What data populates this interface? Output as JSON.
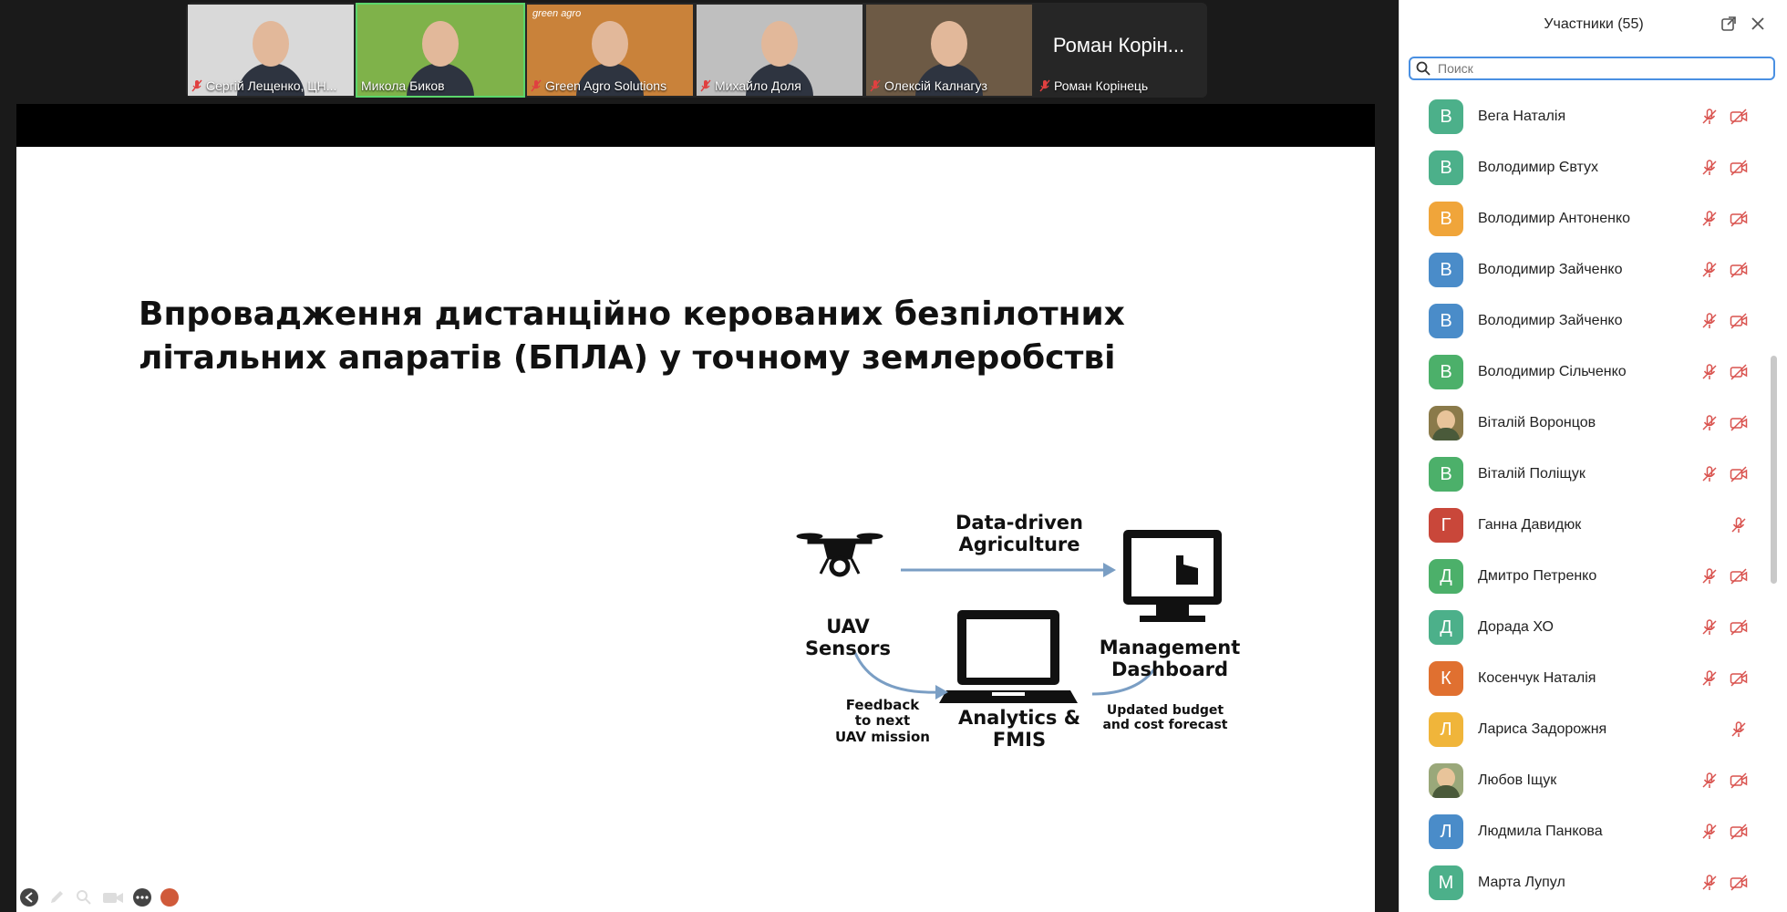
{
  "video_strip": {
    "tiles": [
      {
        "name": "Сергій Лещенко, ЦН...",
        "muted": true,
        "bg": "#d9d9d9"
      },
      {
        "name": "Микола Биков",
        "muted": false,
        "bg": "#7fb24a"
      },
      {
        "name": "Green Agro Solutions",
        "muted": true,
        "bg": "#c9823a",
        "logo_text": "green agro"
      },
      {
        "name": "Михайло Доля",
        "muted": true,
        "bg": "#bfbfbf"
      },
      {
        "name": "Олексій Калнагуз",
        "muted": true,
        "bg": "#6d5a45"
      },
      {
        "name": "Роман Корінець",
        "muted": true,
        "bg": "#262626",
        "display_name": "Роман Корін..."
      }
    ]
  },
  "slide": {
    "title_line1": "Впровадження дистанційно керованих безпілотних",
    "title_line2": "літальних апаратів (БПЛА) у точному землеробстві",
    "diagram": {
      "uav_label": "UAV\nSensors",
      "data_label": "Data-driven\nAgriculture",
      "dashboard_label": "Management\nDashboard",
      "analytics_label": "Analytics &\nFMIS",
      "feedback_label": "Feedback\nto next\nUAV mission",
      "update_label": "Updated budget\nand cost forecast"
    }
  },
  "panel": {
    "title": "Участники (55)",
    "search_placeholder": "Поиск",
    "participants": [
      {
        "initial": "В",
        "name": "Вега Наталія",
        "color": "#4cb08a",
        "mic_off": true,
        "video_off": true
      },
      {
        "initial": "В",
        "name": "Володимир Євтух",
        "color": "#4cb08a",
        "mic_off": true,
        "video_off": true
      },
      {
        "initial": "В",
        "name": "Володимир Антоненко",
        "color": "#f0a53a",
        "mic_off": true,
        "video_off": true
      },
      {
        "initial": "В",
        "name": "Володимир Зайченко",
        "color": "#4a8cc9",
        "mic_off": true,
        "video_off": true
      },
      {
        "initial": "В",
        "name": "Володимир Зайченко",
        "color": "#4a8cc9",
        "mic_off": true,
        "video_off": true
      },
      {
        "initial": "В",
        "name": "Володимир Сільченко",
        "color": "#4cb06a",
        "mic_off": true,
        "video_off": true
      },
      {
        "initial": "",
        "name": "Віталій Воронцов",
        "color": "#8a7a4a",
        "mic_off": true,
        "video_off": true,
        "photo": true
      },
      {
        "initial": "В",
        "name": "Віталій Поліщук",
        "color": "#4cb06a",
        "mic_off": true,
        "video_off": true
      },
      {
        "initial": "Г",
        "name": "Ганна Давидюк",
        "color": "#c9473a",
        "mic_off": true,
        "video_off": false
      },
      {
        "initial": "Д",
        "name": "Дмитро Петренко",
        "color": "#4cb06a",
        "mic_off": true,
        "video_off": true
      },
      {
        "initial": "Д",
        "name": "Дорада ХО",
        "color": "#4cb08a",
        "mic_off": true,
        "video_off": true
      },
      {
        "initial": "К",
        "name": "Косенчук Наталія",
        "color": "#e07030",
        "mic_off": true,
        "video_off": true
      },
      {
        "initial": "Л",
        "name": "Лариса Задорожня",
        "color": "#f0b53a",
        "mic_off": true,
        "video_off": false
      },
      {
        "initial": "",
        "name": "Любов Іщук",
        "color": "#9aa87a",
        "mic_off": true,
        "video_off": true,
        "photo": true
      },
      {
        "initial": "Л",
        "name": "Людмила Панкова",
        "color": "#4a8cc9",
        "mic_off": true,
        "video_off": true
      },
      {
        "initial": "М",
        "name": "Марта Лупул",
        "color": "#4cb08a",
        "mic_off": true,
        "video_off": true
      }
    ]
  }
}
